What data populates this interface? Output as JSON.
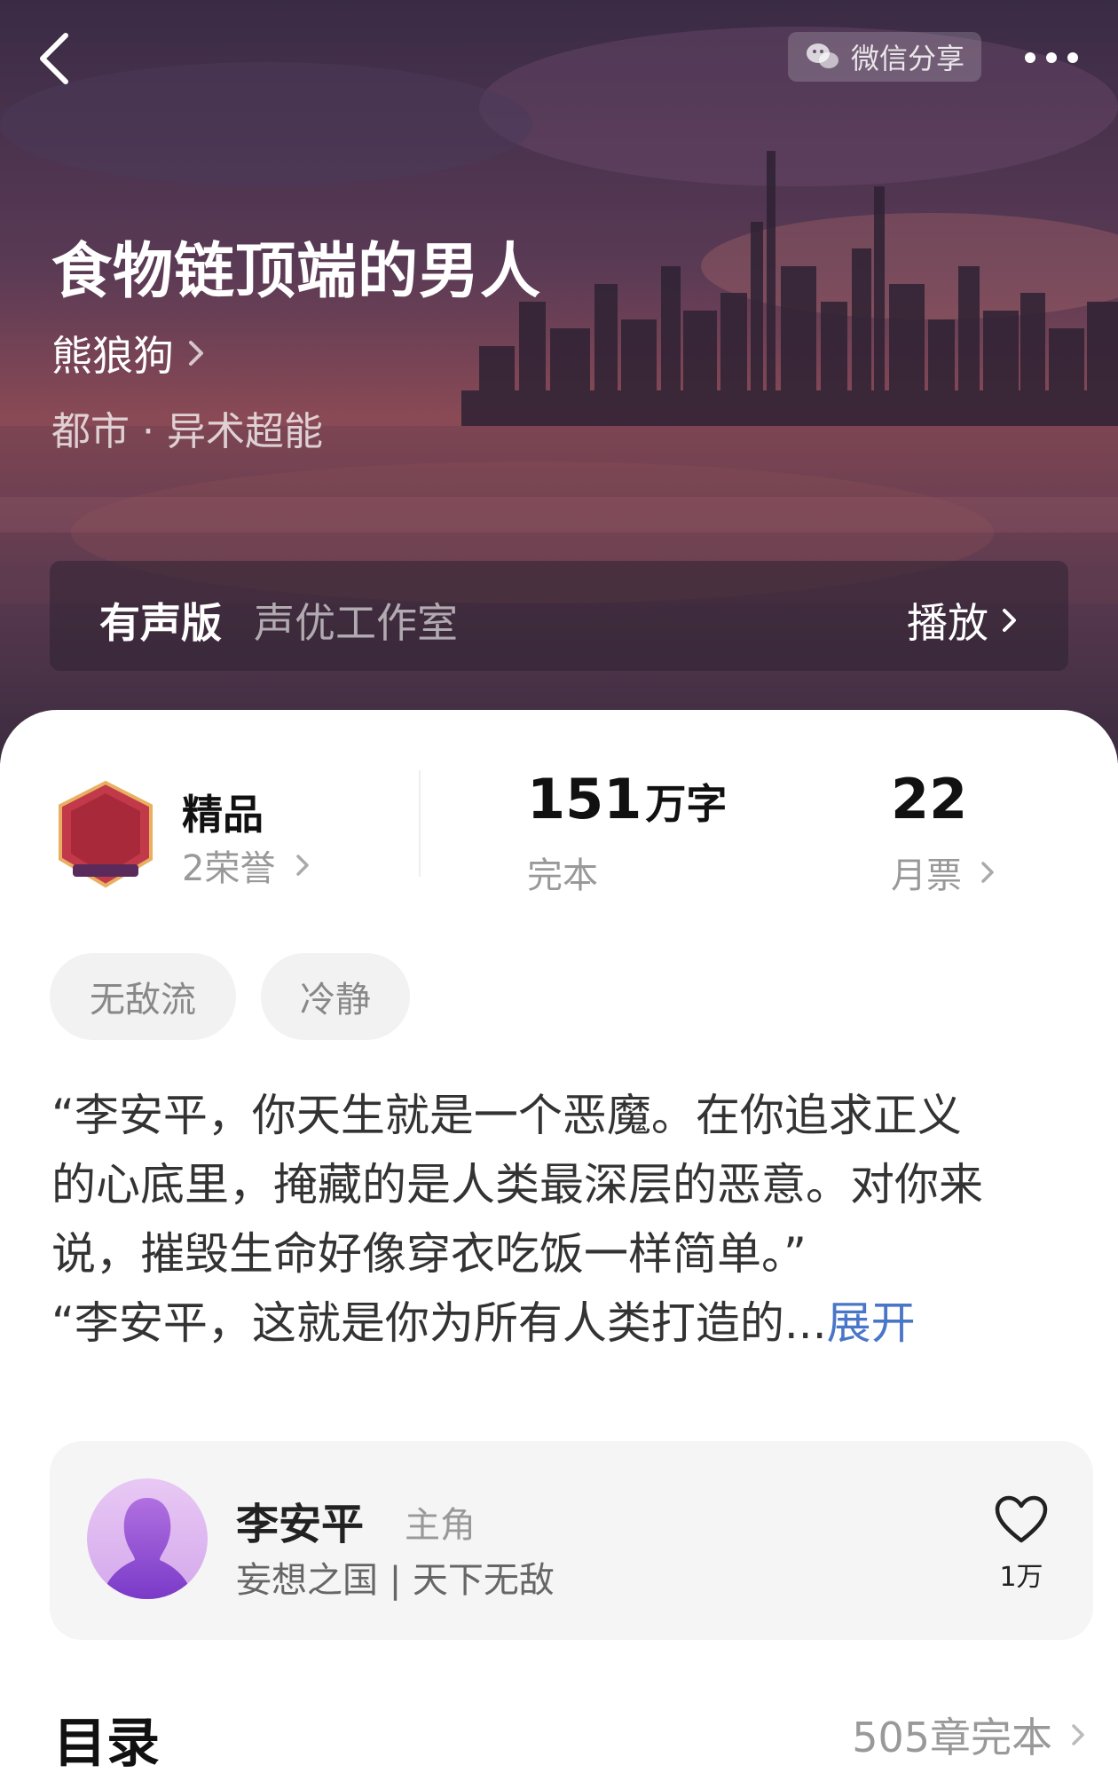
{
  "header": {
    "share_label": "微信分享",
    "book_title": "食物链顶端的男人",
    "author": "熊狼狗",
    "genre": "都市 · 异术超能"
  },
  "audio": {
    "label": "有声版",
    "studio": "声优工作室",
    "play_label": "播放"
  },
  "stats": {
    "badge_text": "精品频道",
    "quality_title": "精品",
    "honors": "2荣誉",
    "word_count": "151",
    "word_unit": "万字",
    "status": "完本",
    "monthly_tickets": "22",
    "monthly_tickets_label": "月票"
  },
  "tags": [
    "无敌流",
    "冷静"
  ],
  "synopsis": {
    "lines": [
      "“李安平，你天生就是一个恶魔。在你追求正义",
      "的心底里，掩藏的是人类最深层的恶意。对你来",
      "说，摧毁生命好像穿衣吃饭一样简单。”",
      "“李安平，这就是你为所有人类打造的..."
    ],
    "expand_label": "展开"
  },
  "character": {
    "name": "李安平",
    "role": "主角",
    "tags": "妄想之国 | 天下无敌",
    "likes": "1万"
  },
  "toc": {
    "title": "目录",
    "chapter_count": "505章完本"
  },
  "colors": {
    "link": "#4a76c8",
    "header_bg": "#4a3350"
  }
}
